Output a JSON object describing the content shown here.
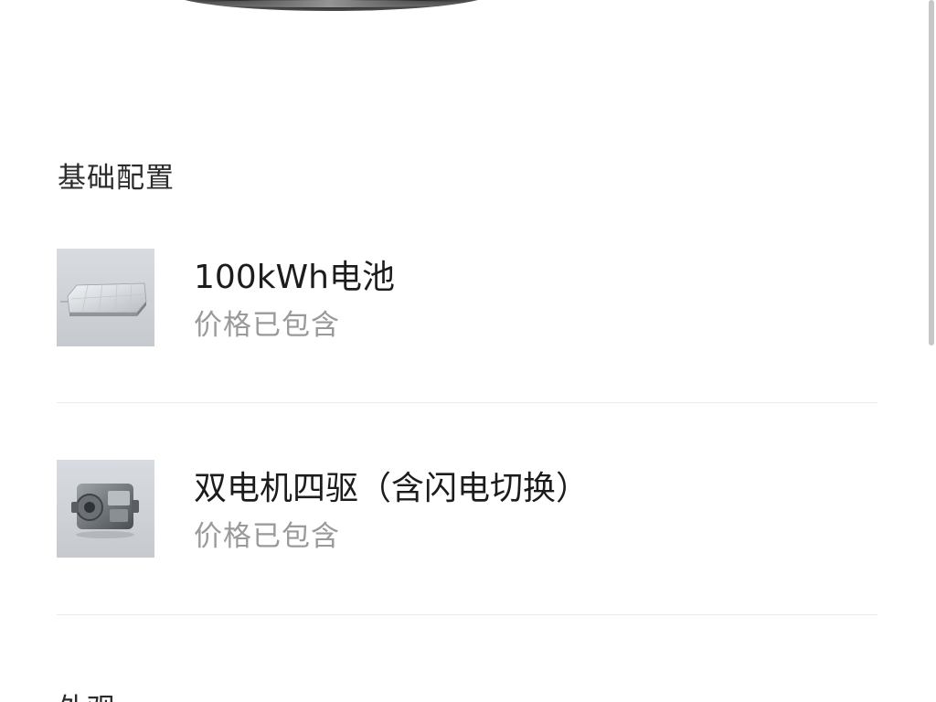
{
  "section": {
    "title": "基础配置"
  },
  "items": [
    {
      "name": "100kWh电池",
      "status": "价格已包含",
      "image_icon": "battery-pack-icon"
    },
    {
      "name": "双电机四驱（含闪电切换）",
      "status": "价格已包含",
      "image_icon": "dual-motor-icon"
    }
  ],
  "next_section": {
    "title": "外观"
  }
}
